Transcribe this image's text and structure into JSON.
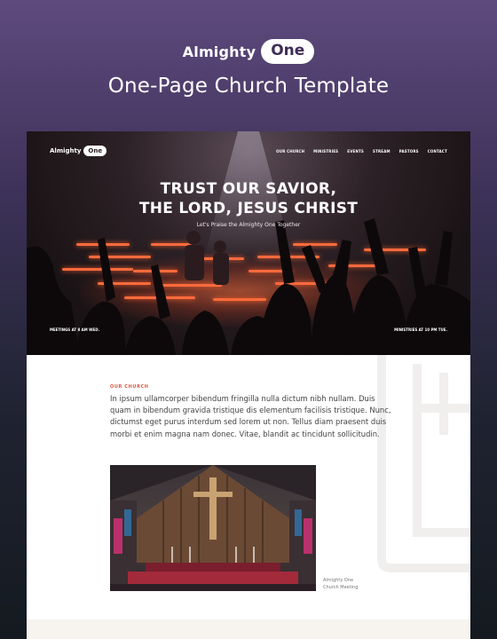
{
  "brand": {
    "word": "Almighty",
    "pill": "One",
    "subtitle": "One-Page Church Template"
  },
  "site": {
    "logo_word": "Almighty",
    "logo_pill": "One",
    "nav": [
      "OUR CHURCH",
      "MINISTRIES",
      "EVENTS",
      "STREAM",
      "PASTORS",
      "CONTACT"
    ],
    "hero": {
      "title_line1": "TRUST OUR SAVIOR,",
      "title_line2": "THE LORD, JESUS CHRIST",
      "subtitle": "Let's Praise the Almighty One Together",
      "left_note": "MEETINGS AT 8 AM WED.",
      "right_note": "MINISTRIES AT 10 PM TUE."
    },
    "section": {
      "label": "OUR CHURCH",
      "text": "In ipsum ullamcorper bibendum fringilla nulla dictum nibh nullam. Duis quam in bibendum gravida tristique dis elementum facilisis tristique. Nunc, dictumst eget purus interdum sed lorem ut non. Tellus diam praesent duis morbi et enim magna nam donec. Vitae, blandit ac tincidunt sollicitudin.",
      "caption_line1": "Almighty One",
      "caption_line2": "Church Meeting"
    }
  },
  "colors": {
    "accent": "#e0563c",
    "bg_top": "#5f4a7e",
    "bg_bottom": "#141a20"
  }
}
